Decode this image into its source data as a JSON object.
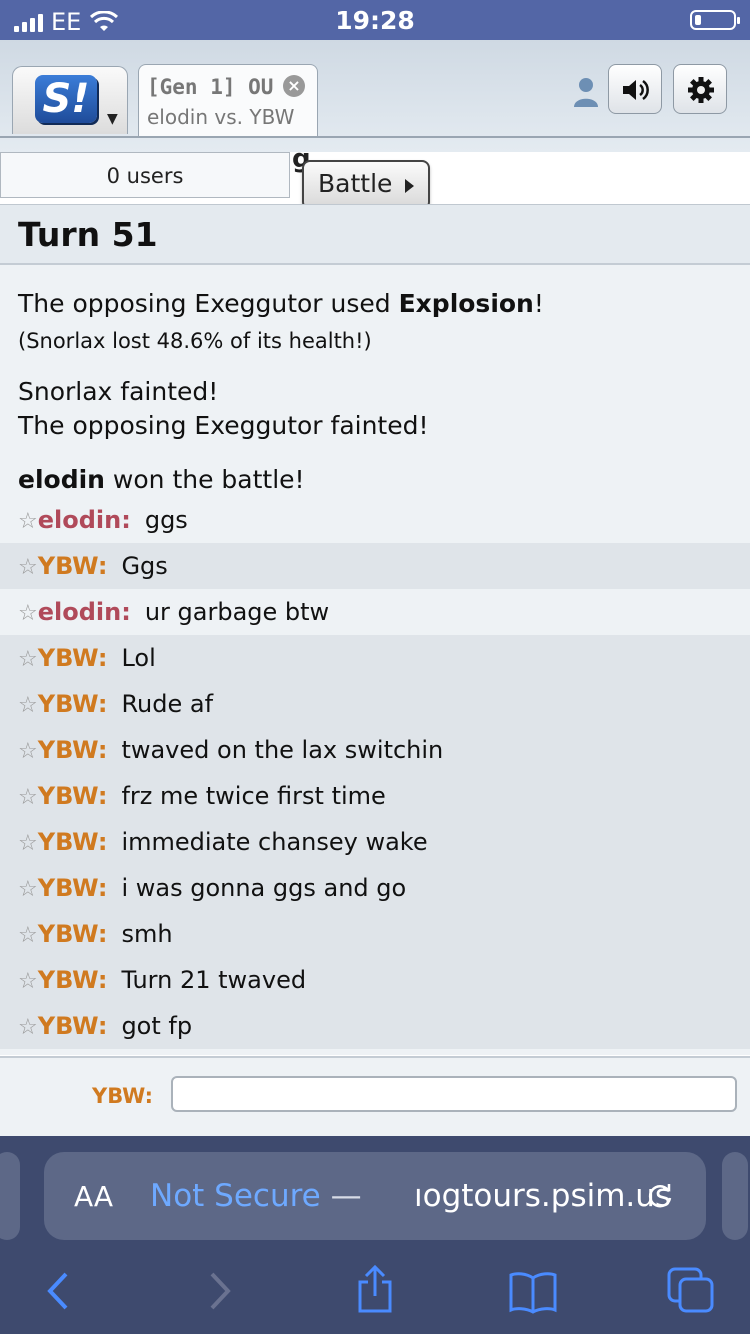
{
  "status": {
    "carrier": "EE",
    "time": "19:28"
  },
  "header": {
    "logo_letter": "S!",
    "tab_title": "[Gen 1] OU",
    "tab_subtitle": "elodin vs. YBW"
  },
  "users_bar": {
    "users_count": "0 users",
    "battle_button": "Battle",
    "hidden_text": "g"
  },
  "log": {
    "turn": "Turn 51",
    "explosion": {
      "prefix": "The opposing Exeggutor used ",
      "move": "Explosion",
      "suffix": "!"
    },
    "damage": "(Snorlax lost 48.6% of its health!)",
    "faint1": "Snorlax fainted!",
    "faint2": "The opposing Exeggutor fainted!",
    "winner": {
      "name": "elodin",
      "text": " won the battle!"
    }
  },
  "chat": [
    {
      "name": "elodin:",
      "text": "ggs",
      "color": "#b04a5a"
    },
    {
      "name": "YBW:",
      "text": "Ggs",
      "color": "#d07a20"
    },
    {
      "name": "elodin:",
      "text": "ur garbage btw",
      "color": "#b04a5a"
    },
    {
      "name": "YBW:",
      "text": "Lol",
      "color": "#d07a20"
    },
    {
      "name": "YBW:",
      "text": "Rude af",
      "color": "#d07a20"
    },
    {
      "name": "YBW:",
      "text": "twaved on the lax switchin",
      "color": "#d07a20"
    },
    {
      "name": "YBW:",
      "text": "frz me twice first time",
      "color": "#d07a20"
    },
    {
      "name": "YBW:",
      "text": "immediate chansey wake",
      "color": "#d07a20"
    },
    {
      "name": "YBW:",
      "text": "i was gonna ggs and go",
      "color": "#d07a20"
    },
    {
      "name": "YBW:",
      "text": "smh",
      "color": "#d07a20"
    },
    {
      "name": "YBW:",
      "text": "Turn 21 twaved",
      "color": "#d07a20"
    },
    {
      "name": "YBW:",
      "text": "got fp",
      "color": "#d07a20"
    }
  ],
  "input": {
    "label": "YBW:",
    "value": ""
  },
  "safari": {
    "aa_label": "AA",
    "not_secure": "Not Secure",
    "separator": " — ",
    "url": "ıogtours.psim.us"
  }
}
